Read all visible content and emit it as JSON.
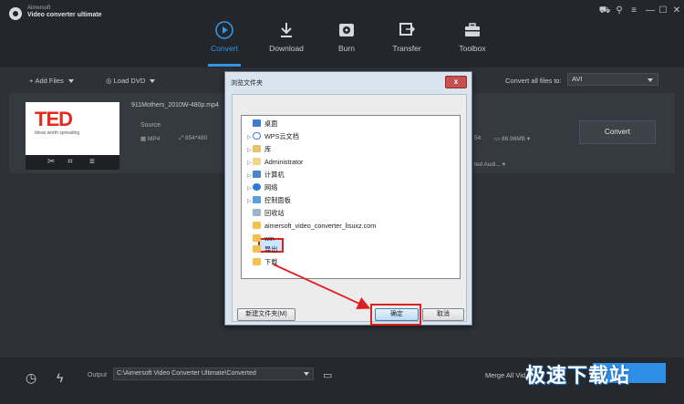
{
  "app": {
    "brand_top": "Aimersoft",
    "brand_main": "Video converter ultimate"
  },
  "window_controls": [
    "cart-icon",
    "key-icon",
    "menu-icon",
    "minimize-icon",
    "maximize-icon",
    "close-icon"
  ],
  "nav": {
    "items": [
      {
        "label": "Convert",
        "icon": "convert-icon",
        "active": true
      },
      {
        "label": "Download",
        "icon": "download-icon",
        "active": false
      },
      {
        "label": "Burn",
        "icon": "burn-icon",
        "active": false
      },
      {
        "label": "Transfer",
        "icon": "transfer-icon",
        "active": false
      },
      {
        "label": "Toolbox",
        "icon": "toolbox-icon",
        "active": false
      }
    ],
    "accent": "#2f96e8"
  },
  "toolbar": {
    "add_files": "Add Files",
    "load_dvd": "Load DVD",
    "convert_all_label": "Convert all files to:",
    "convert_all_value": "AVI"
  },
  "file": {
    "name": "911Mothers_2010W-480p.mp4",
    "thumb_logo": "TED",
    "thumb_sub": "Ideas worth spreading",
    "source_label": "Source",
    "format": "MP4",
    "resolution": "854*480",
    "right_resolution_tail": "54",
    "size": "86.96MB",
    "audio": "ted Audi...",
    "convert_button": "Convert"
  },
  "dialog": {
    "title": "浏览文件夹",
    "close": "x",
    "tree": [
      {
        "label": "桌面",
        "icon": "desktop-icon",
        "expand": ""
      },
      {
        "label": "WPS云文档",
        "icon": "cloud-icon",
        "expand": "▷"
      },
      {
        "label": "库",
        "icon": "library-icon",
        "expand": "▷"
      },
      {
        "label": "Administrator",
        "icon": "user-folder-icon",
        "expand": "▷"
      },
      {
        "label": "计算机",
        "icon": "computer-icon",
        "expand": "▷"
      },
      {
        "label": "网络",
        "icon": "network-icon",
        "expand": "▷"
      },
      {
        "label": "控制面板",
        "icon": "control-panel-icon",
        "expand": "▷"
      },
      {
        "label": "回收站",
        "icon": "recycle-bin-icon",
        "expand": ""
      },
      {
        "label": "aimersoft_video_converter_lisuxz.com",
        "icon": "folder-icon",
        "expand": ""
      },
      {
        "label": "win",
        "icon": "folder-icon",
        "expand": ""
      },
      {
        "label": "导出",
        "icon": "folder-icon",
        "expand": "",
        "selected": true
      },
      {
        "label": "下载",
        "icon": "folder-icon",
        "expand": ""
      }
    ],
    "new_folder": "新建文件夹(M)",
    "ok": "确定",
    "cancel": "取消"
  },
  "bottom": {
    "output_label": "Output",
    "output_path": "C:\\Aimersoft Video Converter Ultimate\\Converted",
    "merge_label": "Merge All Vid",
    "watermark": "极速下载站"
  }
}
